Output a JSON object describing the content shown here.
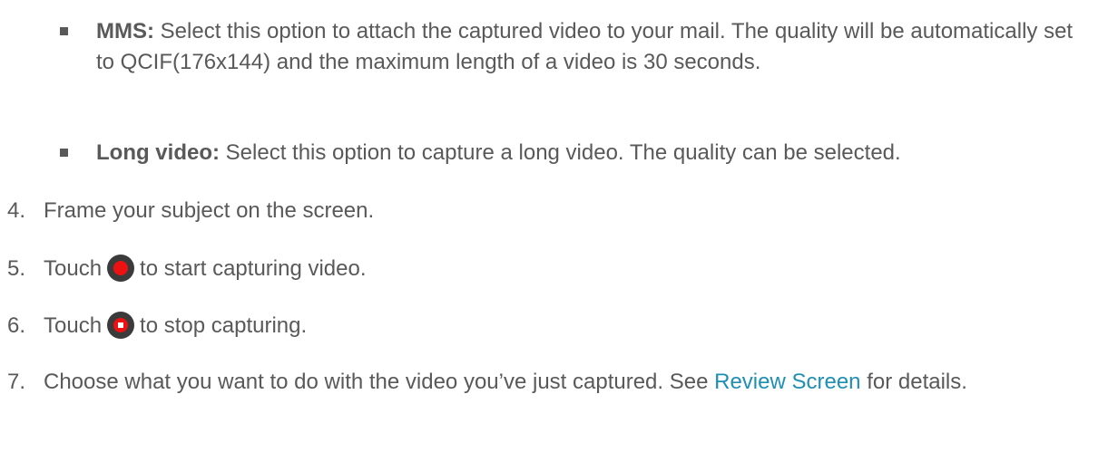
{
  "bullets": [
    {
      "term": "MMS:",
      "text": " Select this option to attach the captured video to your mail. The quality will be automatically set to QCIF(176x144) and the maximum length of a video is 30 seconds."
    },
    {
      "term": "Long video:",
      "text": " Select this option to capture a long video. The quality can be selected."
    }
  ],
  "steps": [
    {
      "num": "4.",
      "text": "Frame your subject on the screen."
    },
    {
      "num": "5.",
      "before": "Touch",
      "after": "to start capturing video.",
      "icon": "record-icon"
    },
    {
      "num": "6.",
      "before": "Touch",
      "after": "to stop capturing.",
      "icon": "stop-record-icon"
    },
    {
      "num": "7.",
      "before": "Choose what you want to do with the video you’ve just captured. See",
      "link": "Review Screen",
      "after": "for details."
    }
  ]
}
